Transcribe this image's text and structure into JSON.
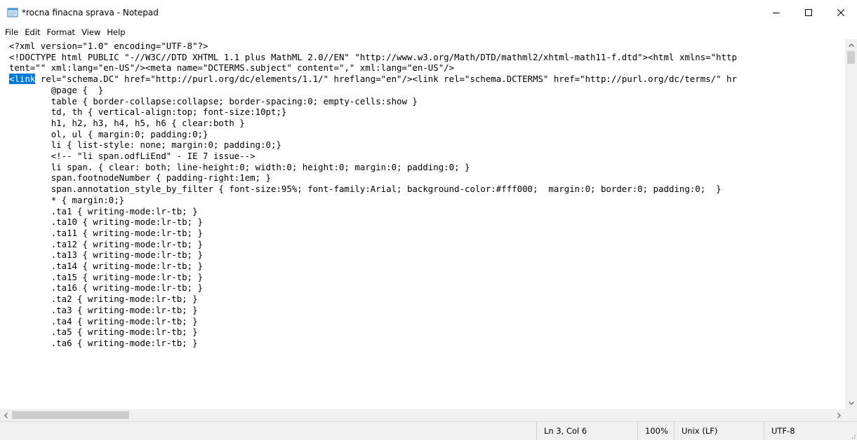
{
  "window": {
    "title": "*rocna finacna sprava - Notepad",
    "icon": "notepad-icon",
    "controls": {
      "minimize": "minimize-icon",
      "maximize": "maximize-icon",
      "close": "close-icon"
    }
  },
  "menu": {
    "items": [
      "File",
      "Edit",
      "Format",
      "View",
      "Help"
    ]
  },
  "editor": {
    "line1": "<?xml version=\"1.0\" encoding=\"UTF-8\"?>",
    "line2": "<!DOCTYPE html PUBLIC \"-//W3C//DTD XHTML 1.1 plus MathML 2.0//EN\" \"http://www.w3.org/Math/DTD/mathml2/xhtml-math11-f.dtd\"><html xmlns=\"http",
    "line3": "tent=\"\" xml:lang=\"en-US\"/><meta name=\"DCTERMS.subject\" content=\",\" xml:lang=\"en-US\"/>",
    "line4_selected": "<link",
    "line4_rest": " rel=\"schema.DC\" href=\"http://purl.org/dc/elements/1.1/\" hreflang=\"en\"/><link rel=\"schema.DCTERMS\" href=\"http://purl.org/dc/terms/\" hr",
    "css_lines": [
      "\t@page {  }",
      "\ttable { border-collapse:collapse; border-spacing:0; empty-cells:show }",
      "\ttd, th { vertical-align:top; font-size:10pt;}",
      "\th1, h2, h3, h4, h5, h6 { clear:both }",
      "\tol, ul { margin:0; padding:0;}",
      "\tli { list-style: none; margin:0; padding:0;}",
      "\t<!-- \"li span.odfLiEnd\" - IE 7 issue-->",
      "\tli span. { clear: both; line-height:0; width:0; height:0; margin:0; padding:0; }",
      "\tspan.footnodeNumber { padding-right:1em; }",
      "\tspan.annotation_style_by_filter { font-size:95%; font-family:Arial; background-color:#fff000;  margin:0; border:0; padding:0;  }",
      "\t* { margin:0;}",
      "\t.ta1 { writing-mode:lr-tb; }",
      "\t.ta10 { writing-mode:lr-tb; }",
      "\t.ta11 { writing-mode:lr-tb; }",
      "\t.ta12 { writing-mode:lr-tb; }",
      "\t.ta13 { writing-mode:lr-tb; }",
      "\t.ta14 { writing-mode:lr-tb; }",
      "\t.ta15 { writing-mode:lr-tb; }",
      "\t.ta16 { writing-mode:lr-tb; }",
      "\t.ta2 { writing-mode:lr-tb; }",
      "\t.ta3 { writing-mode:lr-tb; }",
      "\t.ta4 { writing-mode:lr-tb; }",
      "\t.ta5 { writing-mode:lr-tb; }",
      "\t.ta6 { writing-mode:lr-tb; }"
    ]
  },
  "status": {
    "position": "Ln 3, Col 6",
    "zoom": "100%",
    "line_ending": "Unix (LF)",
    "encoding": "UTF-8"
  },
  "colors": {
    "selection": "#0078d7",
    "chrome": "#f0f0f0",
    "scroll_thumb": "#cdcdcd"
  }
}
